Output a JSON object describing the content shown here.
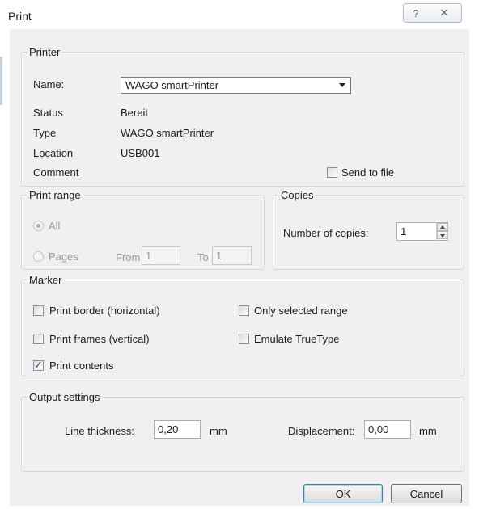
{
  "window": {
    "title": "Print",
    "help_glyph": "?",
    "close_glyph": "✕"
  },
  "printer": {
    "legend": "Printer",
    "name_label": "Name:",
    "name_value": "WAGO smartPrinter",
    "status_label": "Status",
    "status_value": "Bereit",
    "type_label": "Type",
    "type_value": "WAGO smartPrinter",
    "location_label": "Location",
    "location_value": "USB001",
    "comment_label": "Comment",
    "send_to_file_label": "Send to file",
    "send_to_file_checked": false
  },
  "print_range": {
    "legend": "Print range",
    "all_label": "All",
    "pages_label": "Pages",
    "from_label": "From",
    "from_value": "1",
    "to_label": "To",
    "to_value": "1",
    "selected": "All"
  },
  "copies": {
    "legend": "Copies",
    "number_label": "Number of copies:",
    "number_value": "1"
  },
  "marker": {
    "legend": "Marker",
    "print_border_label": "Print border (horizontal)",
    "print_border_checked": false,
    "print_frames_label": "Print frames (vertical)",
    "print_frames_checked": false,
    "print_contents_label": "Print contents",
    "print_contents_checked": true,
    "only_selected_label": "Only selected range",
    "only_selected_checked": false,
    "emulate_truetype_label": "Emulate TrueType",
    "emulate_truetype_checked": false,
    "check_glyph": "✓"
  },
  "output": {
    "legend": "Output settings",
    "line_thickness_label": "Line thickness:",
    "line_thickness_value": "0,20",
    "line_thickness_unit": "mm",
    "displacement_label": "Displacement:",
    "displacement_value": "0,00",
    "displacement_unit": "mm"
  },
  "buttons": {
    "ok_label": "OK",
    "cancel_label": "Cancel"
  }
}
